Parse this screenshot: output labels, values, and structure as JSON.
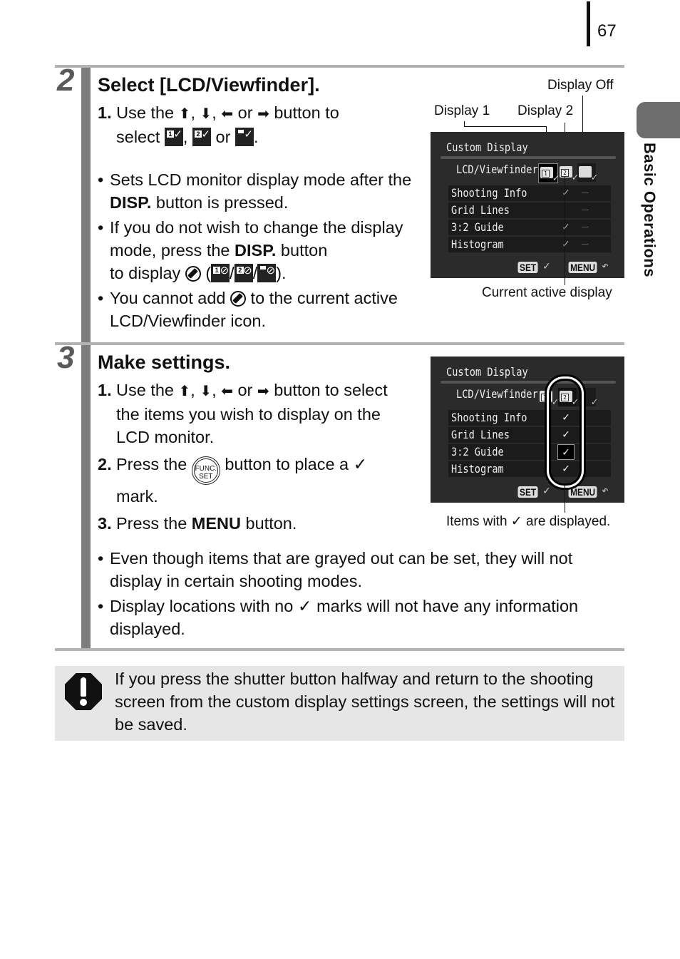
{
  "page": {
    "number": "67",
    "section_tab": "Basic Operations"
  },
  "step2": {
    "number": "2",
    "title": "Select [LCD/Viewfinder].",
    "instr1": {
      "num": "1.",
      "prefix": "Use the",
      "sep1": ",",
      "sep2": ",",
      "or1": "or",
      "suffix": "button to",
      "line2_prefix": "select",
      "line2_sep": ",",
      "line2_or": "or",
      "line2_end": "."
    },
    "bullets": [
      {
        "pre": "Sets LCD monitor display mode after the ",
        "bold": "DISP.",
        "post": " button is pressed."
      },
      {
        "pre": "If you do not wish to change the display mode, press the ",
        "bold": "DISP.",
        "post": " button"
      },
      {
        "line": "to display",
        "paren_open": "(",
        "slash": "/",
        "paren_close": ")."
      },
      {
        "pre": "You cannot add",
        "post": "to the current active LCD/Viewfinder icon."
      }
    ],
    "screen": {
      "title": "Custom Display",
      "row_header": "LCD/Viewfinder",
      "icons": [
        "display-1",
        "display-2",
        "display-off"
      ],
      "rows": [
        {
          "label": "Shooting Info",
          "cells": [
            "",
            "✓",
            "—"
          ]
        },
        {
          "label": "Grid Lines",
          "cells": [
            "",
            "",
            "—"
          ]
        },
        {
          "label": "3:2 Guide",
          "cells": [
            "",
            "✓",
            "—"
          ]
        },
        {
          "label": "Histogram",
          "cells": [
            "",
            "✓",
            "—"
          ]
        }
      ],
      "set_label": "SET",
      "set_action": "✓",
      "menu_label": "MENU",
      "menu_action": "↶"
    },
    "callouts": {
      "display_off": "Display Off",
      "display_1": "Display 1",
      "display_2": "Display 2",
      "current_active": "Current active display"
    }
  },
  "step3": {
    "number": "3",
    "title": "Make settings.",
    "items": [
      {
        "num": "1.",
        "prefix": "Use the",
        "sep1": ",",
        "sep2": ",",
        "or1": "or",
        "suffix": "button to",
        "rest": "select the items you wish to display on the LCD monitor."
      },
      {
        "num": "2.",
        "prefix": "Press the",
        "func_label_1": "FUNC.",
        "func_label_2": "SET",
        "suffix": "button to place a ✓ mark."
      },
      {
        "num": "3.",
        "prefix": "Press the ",
        "bold": "MENU",
        "suffix": " button."
      }
    ],
    "screen": {
      "title": "Custom Display",
      "row_header": "LCD/Viewfinder",
      "rows": [
        {
          "label": "Shooting Info",
          "cells": [
            "",
            "✓",
            ""
          ]
        },
        {
          "label": "Grid Lines",
          "cells": [
            "",
            "✓",
            ""
          ]
        },
        {
          "label": "3:2 Guide",
          "cells": [
            "",
            "✓",
            ""
          ]
        },
        {
          "label": "Histogram",
          "cells": [
            "",
            "✓",
            ""
          ]
        }
      ],
      "set_label": "SET",
      "set_action": "✓",
      "menu_label": "MENU",
      "menu_action": "↶"
    },
    "callout": "Items with ✓ are displayed.",
    "bullets": [
      "Even though items that are grayed out can be set, they will not display in certain shooting modes.",
      "Display locations with no ✓ marks will not have any information displayed."
    ]
  },
  "note": {
    "icon": "caution-icon",
    "text": "If you press the shutter button halfway and return to the shooting screen from the custom display settings screen, the settings will not be saved."
  },
  "glyphs": {
    "up": "⬆",
    "down": "⬇",
    "left": "⬅",
    "right": "➡",
    "check": "✓",
    "bullet": "•"
  }
}
